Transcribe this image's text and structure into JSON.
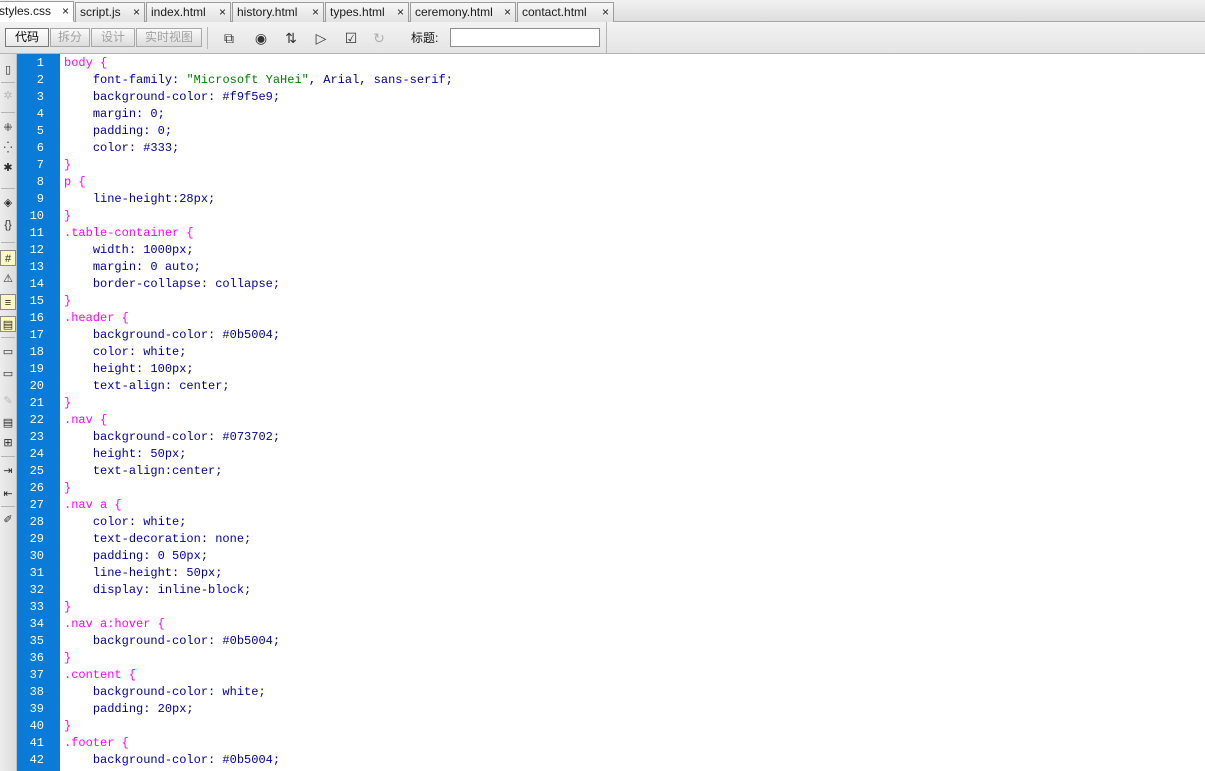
{
  "tabs": [
    {
      "label": "styles.css",
      "close": "×",
      "active": true
    },
    {
      "label": "script.js",
      "close": "×",
      "active": false
    },
    {
      "label": "index.html",
      "close": "×",
      "active": false
    },
    {
      "label": "history.html",
      "close": "×",
      "active": false
    },
    {
      "label": "types.html",
      "close": "×",
      "active": false
    },
    {
      "label": "ceremony.html",
      "close": "×",
      "active": false
    },
    {
      "label": "contact.html",
      "close": "×",
      "active": false
    }
  ],
  "toolbar": {
    "view_buttons": [
      {
        "label": "代码",
        "active": true
      },
      {
        "label": "拆分",
        "active": false
      },
      {
        "label": "设计",
        "active": false
      },
      {
        "label": "实时视图",
        "active": false
      }
    ],
    "icons": [
      {
        "name": "multiscreen-icon",
        "glyph": "⧉",
        "dim": false
      },
      {
        "name": "preview-browser-icon",
        "glyph": "◉",
        "dim": false
      },
      {
        "name": "file-management-icon",
        "glyph": "⇅",
        "dim": false
      },
      {
        "name": "check-browser-compat-icon",
        "glyph": "▷",
        "dim": false
      },
      {
        "name": "visual-aids-icon",
        "glyph": "☑",
        "dim": false
      },
      {
        "name": "refresh-icon",
        "glyph": "↻",
        "dim": true
      }
    ],
    "title_label": "标题:",
    "title_value": ""
  },
  "left_tools": [
    {
      "name": "open-documents-icon",
      "glyph": "▯",
      "dim": false,
      "hl": false
    },
    {
      "name": "show-code-navigator-icon",
      "glyph": "✲",
      "dim": true,
      "hl": false
    },
    {
      "name": "collapse-full-tag-icon",
      "glyph": "⁜",
      "dim": false,
      "hl": false
    },
    {
      "name": "collapse-selection-icon",
      "glyph": "⁛",
      "dim": false,
      "hl": false
    },
    {
      "name": "expand-all-icon",
      "glyph": "✱",
      "dim": false,
      "hl": false
    },
    {
      "name": "select-parent-tag-icon",
      "glyph": "◈",
      "dim": false,
      "hl": false
    },
    {
      "name": "balance-braces-icon",
      "glyph": "{}",
      "dim": false,
      "hl": false
    },
    {
      "name": "line-numbers-icon",
      "glyph": "#",
      "dim": false,
      "hl": true
    },
    {
      "name": "highlight-invalid-code-icon",
      "glyph": "⚠",
      "dim": false,
      "hl": false
    },
    {
      "name": "word-wrap-icon",
      "glyph": "≡",
      "dim": false,
      "hl": true
    },
    {
      "name": "syntax-coloring-icon",
      "glyph": "▤",
      "dim": false,
      "hl": true
    },
    {
      "name": "apply-comment-icon",
      "glyph": "▭",
      "dim": false,
      "hl": false
    },
    {
      "name": "remove-comment-icon",
      "glyph": "▭",
      "dim": false,
      "hl": false
    },
    {
      "name": "wrap-tag-icon",
      "glyph": "✎",
      "dim": true,
      "hl": false
    },
    {
      "name": "recent-snippets-icon",
      "glyph": "▤",
      "dim": false,
      "hl": false
    },
    {
      "name": "move-css-icon",
      "glyph": "⊞",
      "dim": false,
      "hl": false
    },
    {
      "name": "indent-code-icon",
      "glyph": "⇥",
      "dim": false,
      "hl": false
    },
    {
      "name": "outdent-code-icon",
      "glyph": "⇤",
      "dim": false,
      "hl": false
    },
    {
      "name": "format-source-icon",
      "glyph": "✐",
      "dim": false,
      "hl": false
    }
  ],
  "code_lines": [
    {
      "n": "1",
      "indent": "",
      "sel": "body {"
    },
    {
      "n": "2",
      "indent": "    ",
      "prop": "font-family: ",
      "str": "\"Microsoft YaHei\"",
      "rest": ", Arial, sans-serif;"
    },
    {
      "n": "3",
      "indent": "    ",
      "prop": "background-color: #f9f5e9;"
    },
    {
      "n": "4",
      "indent": "    ",
      "prop": "margin: 0;"
    },
    {
      "n": "5",
      "indent": "    ",
      "prop": "padding: 0;"
    },
    {
      "n": "6",
      "indent": "    ",
      "prop": "color: #333;"
    },
    {
      "n": "7",
      "indent": "",
      "sel": "}"
    },
    {
      "n": "8",
      "indent": "",
      "sel": "p {"
    },
    {
      "n": "9",
      "indent": "    ",
      "prop": "line-height:28px;"
    },
    {
      "n": "10",
      "indent": "",
      "sel": "}"
    },
    {
      "n": "11",
      "indent": "",
      "sel": ".table-container {"
    },
    {
      "n": "12",
      "indent": "    ",
      "prop": "width: 1000px;"
    },
    {
      "n": "13",
      "indent": "    ",
      "prop": "margin: 0 auto;"
    },
    {
      "n": "14",
      "indent": "    ",
      "prop": "border-collapse: collapse;"
    },
    {
      "n": "15",
      "indent": "",
      "sel": "}"
    },
    {
      "n": "16",
      "indent": "",
      "sel": ".header {"
    },
    {
      "n": "17",
      "indent": "    ",
      "prop": "background-color: #0b5004;"
    },
    {
      "n": "18",
      "indent": "    ",
      "prop": "color: white;"
    },
    {
      "n": "19",
      "indent": "    ",
      "prop": "height: 100px;"
    },
    {
      "n": "20",
      "indent": "    ",
      "prop": "text-align: center;"
    },
    {
      "n": "21",
      "indent": "",
      "sel": "}"
    },
    {
      "n": "22",
      "indent": "",
      "sel": ".nav {"
    },
    {
      "n": "23",
      "indent": "    ",
      "prop": "background-color: #073702;"
    },
    {
      "n": "24",
      "indent": "    ",
      "prop": "height: 50px;"
    },
    {
      "n": "25",
      "indent": "    ",
      "prop": "text-align:center;"
    },
    {
      "n": "26",
      "indent": "",
      "sel": "}"
    },
    {
      "n": "27",
      "indent": "",
      "sel": ".nav a {"
    },
    {
      "n": "28",
      "indent": "    ",
      "prop": "color: white;"
    },
    {
      "n": "29",
      "indent": "    ",
      "prop": "text-decoration: none;"
    },
    {
      "n": "30",
      "indent": "    ",
      "prop": "padding: 0 50px;"
    },
    {
      "n": "31",
      "indent": "    ",
      "prop": "line-height: 50px;"
    },
    {
      "n": "32",
      "indent": "    ",
      "prop": "display: inline-block;"
    },
    {
      "n": "33",
      "indent": "",
      "sel": "}"
    },
    {
      "n": "34",
      "indent": "",
      "sel": ".nav a:hover {"
    },
    {
      "n": "35",
      "indent": "    ",
      "prop": "background-color: #0b5004;"
    },
    {
      "n": "36",
      "indent": "",
      "sel": "}"
    },
    {
      "n": "37",
      "indent": "",
      "sel": ".content {"
    },
    {
      "n": "38",
      "indent": "    ",
      "prop": "background-color: white;"
    },
    {
      "n": "39",
      "indent": "    ",
      "prop": "padding: 20px;"
    },
    {
      "n": "40",
      "indent": "",
      "sel": "}"
    },
    {
      "n": "41",
      "indent": "",
      "sel": ".footer {"
    },
    {
      "n": "42",
      "indent": "    ",
      "prop": "background-color: #0b5004;"
    }
  ],
  "colors": {
    "gutter": "#0a7bd6",
    "selector": "#ff00ff",
    "property": "#0000a0",
    "string": "#008000"
  }
}
